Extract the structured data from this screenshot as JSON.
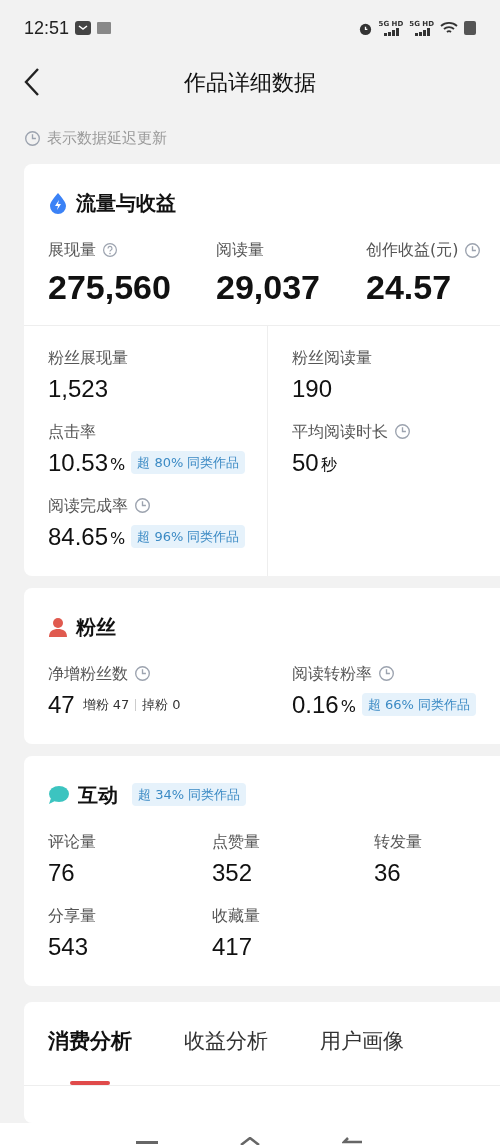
{
  "status_bar": {
    "time": "12:51",
    "network_1": "5G HD",
    "network_2": "5G HD"
  },
  "header": {
    "title": "作品详细数据"
  },
  "note": "表示数据延迟更新",
  "traffic": {
    "title": "流量与收益",
    "top_metrics": [
      {
        "label": "展现量",
        "hint": true,
        "delayed": false,
        "value": "275,560"
      },
      {
        "label": "阅读量",
        "hint": false,
        "delayed": false,
        "value": "29,037"
      },
      {
        "label": "创作收益(元)",
        "hint": false,
        "delayed": true,
        "value": "24.57"
      }
    ],
    "left_metrics": [
      {
        "label": "粉丝展现量",
        "delayed": false,
        "value": "1,523"
      },
      {
        "label": "点击率",
        "delayed": false,
        "value": "10.53",
        "unit": "%",
        "badge": "超 80% 同类作品"
      },
      {
        "label": "阅读完成率",
        "delayed": true,
        "value": "84.65",
        "unit": "%",
        "badge": "超 96% 同类作品"
      }
    ],
    "right_metrics": [
      {
        "label": "粉丝阅读量",
        "delayed": false,
        "value": "190"
      },
      {
        "label": "平均阅读时长",
        "delayed": true,
        "value": "50",
        "unit": "秒"
      }
    ]
  },
  "fans": {
    "title": "粉丝",
    "net": {
      "label": "净增粉丝数",
      "delayed": true,
      "value": "47",
      "gain_label": "增粉",
      "gain": "47",
      "loss_label": "掉粉",
      "loss": "0"
    },
    "conversion": {
      "label": "阅读转粉率",
      "delayed": true,
      "value": "0.16",
      "unit": "%",
      "badge": "超 66% 同类作品"
    }
  },
  "interaction": {
    "title": "互动",
    "badge": "超 34% 同类作品",
    "metrics": [
      {
        "label": "评论量",
        "value": "76"
      },
      {
        "label": "点赞量",
        "value": "352"
      },
      {
        "label": "转发量",
        "value": "36"
      },
      {
        "label": "分享量",
        "value": "543"
      },
      {
        "label": "收藏量",
        "value": "417"
      }
    ]
  },
  "analysis_tabs": [
    {
      "label": "消费分析",
      "selected": true
    },
    {
      "label": "收益分析",
      "selected": false
    },
    {
      "label": "用户画像",
      "selected": false
    }
  ]
}
